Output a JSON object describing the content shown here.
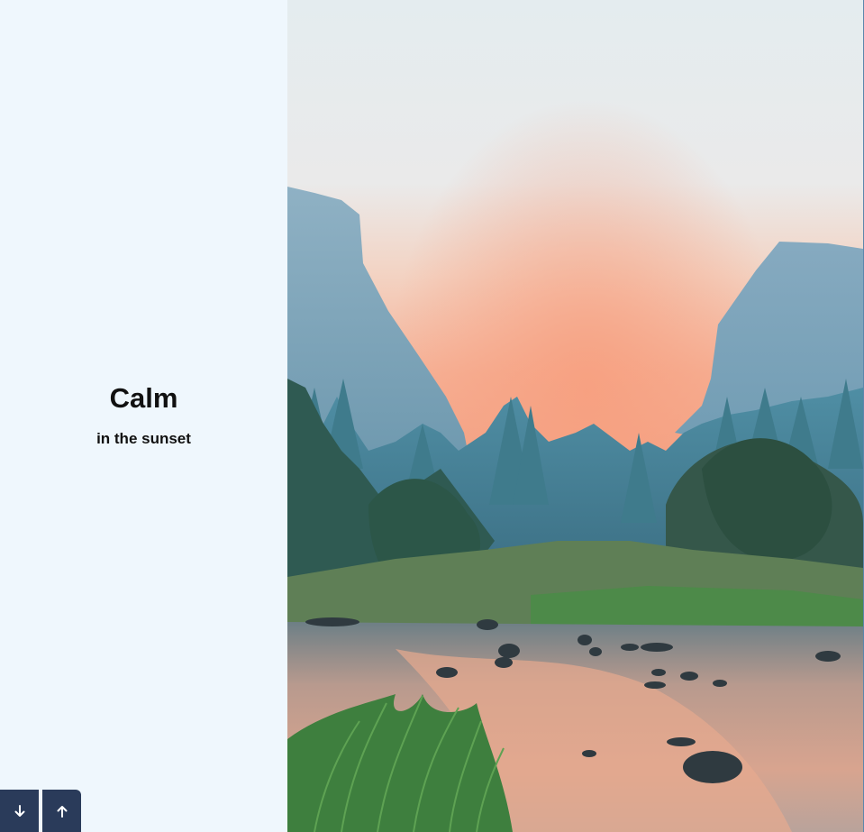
{
  "slide": {
    "title": "Calm",
    "subtitle": "in the sunset"
  },
  "image": {
    "icon": "landscape-sunset-river"
  },
  "controls": {
    "down_icon": "arrow-down-icon",
    "up_icon": "arrow-up-icon"
  },
  "colors": {
    "panel_background": "#eff7fd",
    "button_background": "#2a3b5a",
    "text": "#111111"
  }
}
